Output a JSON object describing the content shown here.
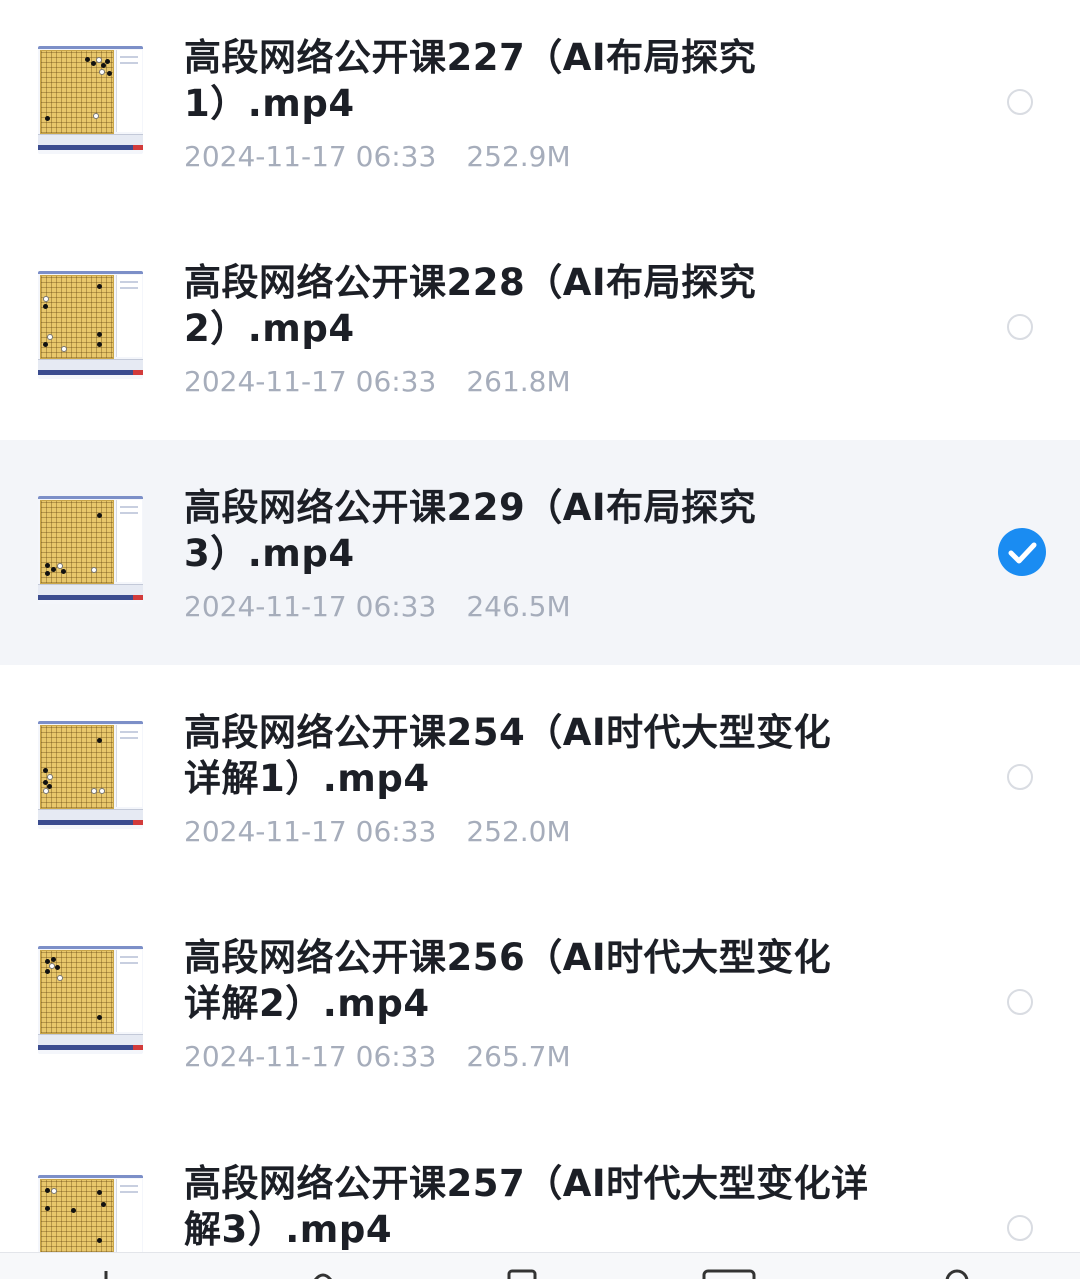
{
  "files": [
    {
      "title_line1": "高段网络公开课227（AI布局探究",
      "title_line2": "1）.mp4",
      "date": "2024-11-17 06:33",
      "size": "252.9M",
      "selected": false
    },
    {
      "title_line1": "高段网络公开课228（AI布局探究",
      "title_line2": "2）.mp4",
      "date": "2024-11-17 06:33",
      "size": "261.8M",
      "selected": false
    },
    {
      "title_line1": "高段网络公开课229（AI布局探究",
      "title_line2": "3）.mp4",
      "date": "2024-11-17 06:33",
      "size": "246.5M",
      "selected": true
    },
    {
      "title_line1": "高段网络公开课254（AI时代大型变化",
      "title_line2": "详解1）.mp4",
      "date": "2024-11-17 06:33",
      "size": "252.0M",
      "selected": false
    },
    {
      "title_line1": "高段网络公开课256（AI时代大型变化",
      "title_line2": "详解2）.mp4",
      "date": "2024-11-17 06:33",
      "size": "265.7M",
      "selected": false
    },
    {
      "title_line1": "高段网络公开课257（AI时代大型变化详",
      "title_line2": "解3）.mp4",
      "date": "",
      "size": "",
      "selected": false
    }
  ],
  "icons": {
    "thumbnail": "video-thumbnail-go-board-icon",
    "unselected": "radio-unchecked-icon",
    "selected": "checkmark-circle-icon"
  },
  "colors": {
    "accent": "#1a8cf2",
    "selected_row_bg": "#f3f5f9",
    "title_text": "#1c1f26",
    "meta_text": "#a6adbb"
  }
}
